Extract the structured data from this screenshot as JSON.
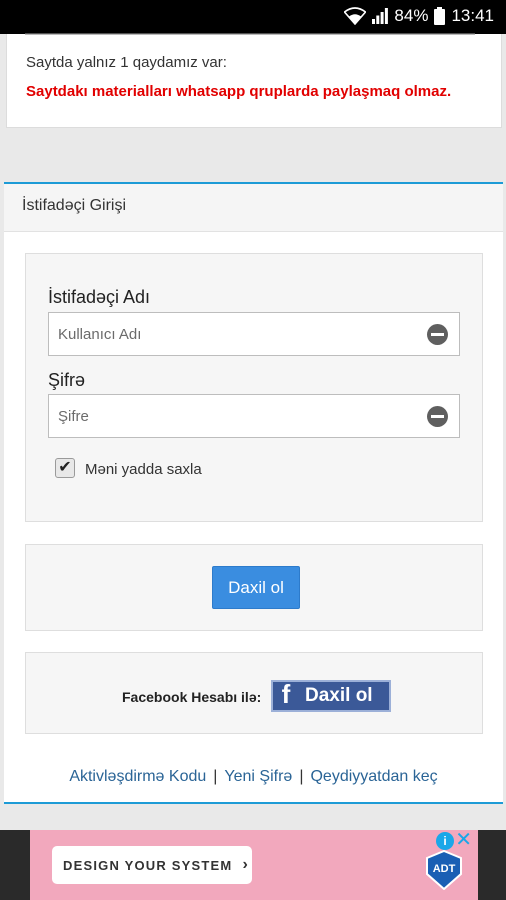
{
  "status_bar": {
    "battery": "84%",
    "time": "13:41"
  },
  "notice": {
    "rules_text": "Saytda yalnız 1 qaydamız var:",
    "warning_text": "Saytdakı materialları whatsapp qruplarda paylaşmaq olmaz.",
    "warning_color": "#e10000"
  },
  "login": {
    "title": "İstifadəçi Girişi",
    "username_label": "İstifadəçi Adı",
    "username_placeholder": "Kullanıcı Adı",
    "password_label": "Şifrə",
    "password_placeholder": "Şifre",
    "remember_label": "Məni yadda saxla",
    "remember_checked": true,
    "submit_label": "Daxil ol",
    "accent_color": "#1d9bd6"
  },
  "facebook": {
    "prefix": "Facebook Hesabı ilə:",
    "button_label": "Daxil ol",
    "brand_color": "#3b5998"
  },
  "footer_links": {
    "activation": "Aktivləşdirmə Kodu",
    "new_password": "Yeni Şifrə",
    "register": "Qeydiyyatdan keç",
    "separator": "|"
  },
  "ad": {
    "cta": "DESIGN YOUR SYSTEM",
    "cta_arrow": "›",
    "brand": "ADT",
    "info_icon": "i",
    "close_icon": "✕"
  }
}
